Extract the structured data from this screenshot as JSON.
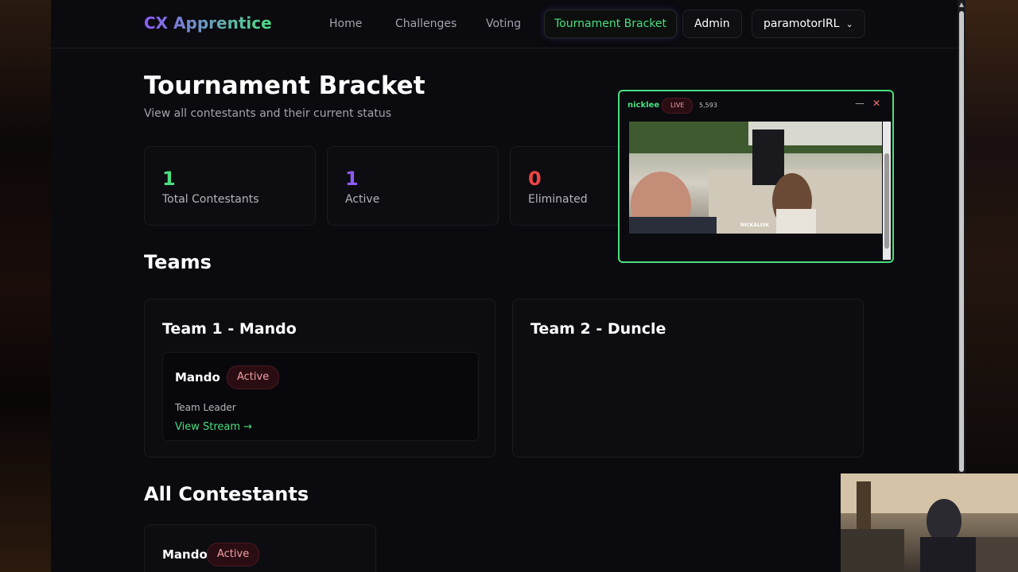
{
  "nav": {
    "logo": "CX Apprentice",
    "links": [
      "Home",
      "Challenges",
      "Voting"
    ],
    "active": "Tournament Bracket",
    "admin": "Admin",
    "user": "paramotorIRL"
  },
  "header": {
    "title": "Tournament Bracket",
    "subtitle": "View all contestants and their current status"
  },
  "stats": [
    {
      "value": "1",
      "label": "Total Contestants",
      "color": "#4ade80"
    },
    {
      "value": "1",
      "label": "Active",
      "color": "#8b5cf6"
    },
    {
      "value": "0",
      "label": "Eliminated",
      "color": "#ef4444"
    }
  ],
  "teams_title": "Teams",
  "teams": [
    {
      "name": "Team 1 - Mando",
      "members": [
        {
          "name": "Mando",
          "status": "Active",
          "role": "Team Leader",
          "link": "View Stream →"
        }
      ]
    },
    {
      "name": "Team 2 - Duncle",
      "members": []
    }
  ],
  "all_title": "All Contestants",
  "contestants": [
    {
      "name": "Mando",
      "status": "Active"
    }
  ],
  "popup": {
    "channel": "nicklee",
    "live": "LIVE",
    "viewers": "5,593",
    "caption": "NICKALISK"
  }
}
